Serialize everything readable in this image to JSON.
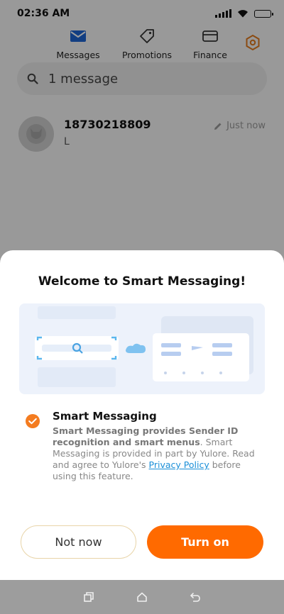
{
  "status_bar": {
    "time": "02:36 AM"
  },
  "tabs": [
    {
      "label": "Messages",
      "icon": "envelope-icon",
      "active": true
    },
    {
      "label": "Promotions",
      "icon": "tag-icon"
    },
    {
      "label": "Finance",
      "icon": "card-icon"
    }
  ],
  "search": {
    "placeholder": "1 message"
  },
  "conversation": {
    "sender": "18730218809",
    "preview": "L",
    "time": "Just now"
  },
  "dialog": {
    "title": "Welcome to Smart Messaging!",
    "option_title": "Smart Messaging",
    "desc_bold": "Smart Messaging provides Sender ID recognition and smart menus",
    "desc_text": ". Smart Messaging is provided in part by Yulore. Read and agree to Yulore's ",
    "link": "Privacy Policy",
    "desc_end": " before using this feature.",
    "not_now": "Not now",
    "turn_on": "Turn on"
  },
  "colors": {
    "accent": "#ff6a00",
    "link": "#1a8fd8",
    "tab_active": "#1d64d2"
  }
}
